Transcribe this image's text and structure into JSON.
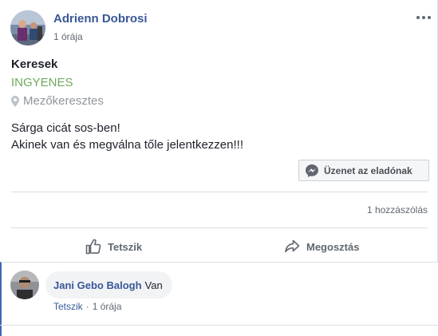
{
  "post": {
    "author": "Adrienn Dobrosi",
    "time": "1 órája",
    "more_icon": "more-dots-icon"
  },
  "listing": {
    "title": "Keresek",
    "price": "INGYENES",
    "location": "Mezőkeresztes",
    "description_line1": "Sárga cicát sos-ben!",
    "description_line2": "Akinek van és megválna tőle jelentkezzen!!!",
    "price_color": "#6fa85c"
  },
  "message_button": {
    "label": "Üzenet az eladónak",
    "icon": "messenger-icon"
  },
  "stats": {
    "comments": "1 hozzászólás"
  },
  "actions": {
    "like": "Tetszik",
    "share": "Megosztás"
  },
  "comment": {
    "author": "Jani Gebo Balogh",
    "text": "Van",
    "like": "Tetszik",
    "separator": "·",
    "time": "1 órája"
  },
  "colors": {
    "link": "#385898",
    "accent": "#4267b2",
    "muted": "#616770"
  }
}
